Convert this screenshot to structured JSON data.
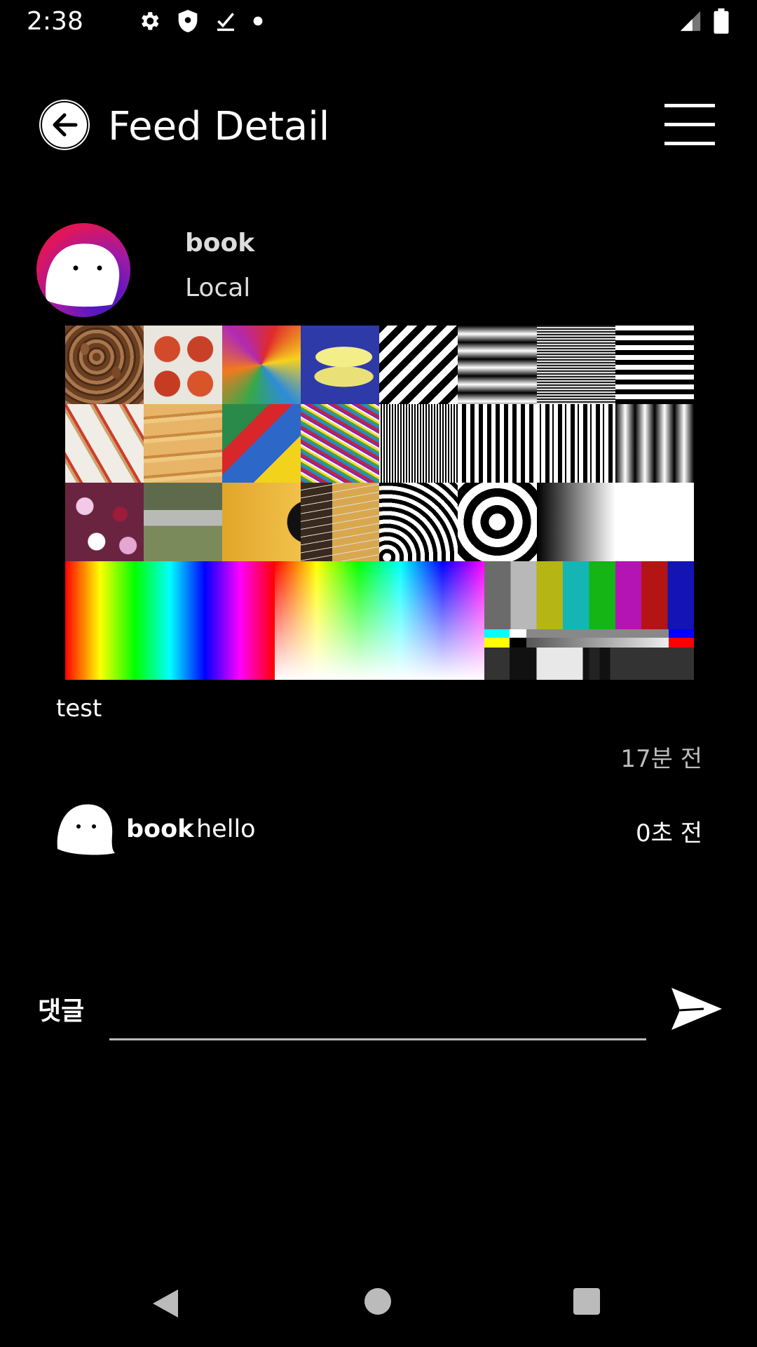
{
  "status_bar": {
    "time": "2:38",
    "icons_left": [
      "gear-icon",
      "shield-icon",
      "download-done-icon",
      "dot-icon"
    ],
    "icons_right": [
      "signal-icon",
      "battery-icon"
    ]
  },
  "app_bar": {
    "title": "Feed Detail",
    "back_icon": "arrow-left-circle-icon",
    "menu_icon": "hamburger-menu-icon"
  },
  "author": {
    "name": "book",
    "subtitle": "Local"
  },
  "post": {
    "text": "test",
    "time": "17분 전",
    "image_tiles": [
      "almonds",
      "apples",
      "feathers",
      "bananas",
      "diagonal-stripes",
      "horizontal-gradient-bars",
      "fine-lines",
      "horizontal-stripes",
      "cards",
      "carrots",
      "plastic-toy",
      "paperclips",
      "vertical-lines-fine",
      "vertical-lines-medium",
      "vertical-lines-mixed",
      "vertical-gradient-bars",
      "flowers",
      "bench",
      "guitar",
      "guitar-strings",
      "arc-rings",
      "concentric-circles",
      "gray-gradient",
      "white-block"
    ],
    "wide_tiles": [
      "hue-spectrum",
      "rgb-triangles",
      "color-test-bars"
    ]
  },
  "comment": {
    "user": "book",
    "text": "hello",
    "time": "0초 전"
  },
  "comment_input": {
    "label": "댓글",
    "value": "",
    "send_icon": "send-icon"
  },
  "nav_bar": {
    "icons": [
      "nav-back-icon",
      "nav-home-icon",
      "nav-recents-icon"
    ]
  },
  "colors": {
    "background": "#000000",
    "avatar_gradient_start": "#e0155a",
    "avatar_gradient_end": "#3b17c8",
    "muted_text": "#bbbbbb"
  }
}
